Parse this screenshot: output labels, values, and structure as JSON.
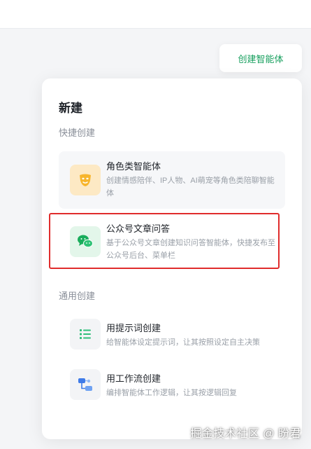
{
  "header": {
    "create_agent_label": "创建智能体"
  },
  "panel": {
    "title": "新建",
    "quick_section_label": "快捷创建",
    "general_section_label": "通用创建",
    "quick_items": [
      {
        "title": "角色类智能体",
        "desc": "创建情感陪伴、IP人物、AI萌宠等角色类陪聊智能体",
        "icon": "mask-icon"
      },
      {
        "title": "公众号文章问答",
        "desc": "基于公众号文章创建知识问答智能体，快捷发布至公众号后台、菜单栏",
        "icon": "wechat-icon"
      }
    ],
    "general_items": [
      {
        "title": "用提示词创建",
        "desc": "给智能体设定提示词，让其按照设定自主决策",
        "icon": "list-icon"
      },
      {
        "title": "用工作流创建",
        "desc": "编排智能体工作逻辑，让其按逻辑回复",
        "icon": "workflow-icon"
      }
    ]
  },
  "watermark": "掘金技术社区 @ 盼君",
  "colors": {
    "accent_green": "#19a05f",
    "highlight_red": "#e02c2c",
    "mask_bg": "#fde9c4",
    "wechat_bg": "#e3f6ea"
  }
}
